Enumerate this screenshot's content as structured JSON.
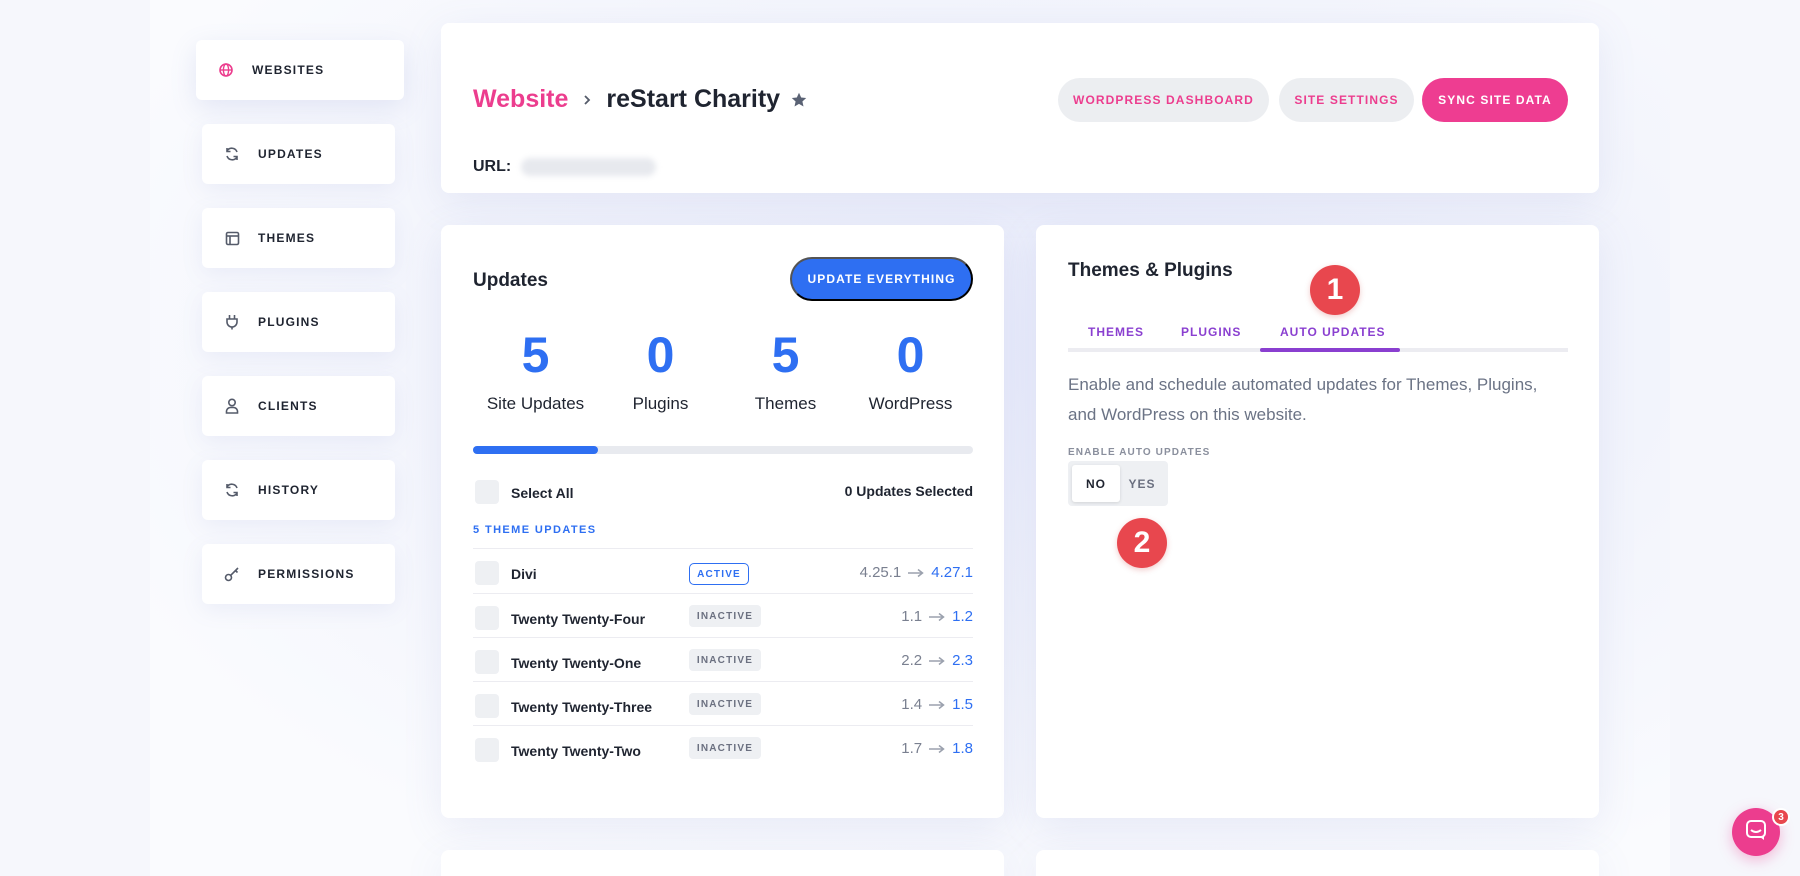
{
  "sidebar": {
    "items": [
      {
        "label": "WEBSITES",
        "icon": "globe-icon",
        "active": true
      },
      {
        "label": "UPDATES",
        "icon": "refresh-icon",
        "active": false
      },
      {
        "label": "THEMES",
        "icon": "layout-icon",
        "active": false
      },
      {
        "label": "PLUGINS",
        "icon": "plug-icon",
        "active": false
      },
      {
        "label": "CLIENTS",
        "icon": "user-icon",
        "active": false
      },
      {
        "label": "HISTORY",
        "icon": "history-icon",
        "active": false
      },
      {
        "label": "PERMISSIONS",
        "icon": "key-icon",
        "active": false
      }
    ]
  },
  "header": {
    "breadcrumb_root": "Website",
    "site_name": "reStart Charity",
    "url_label": "URL:",
    "buttons": {
      "wp_dashboard": "WORDPRESS DASHBOARD",
      "site_settings": "SITE SETTINGS",
      "sync": "SYNC SITE DATA"
    }
  },
  "updates": {
    "title": "Updates",
    "update_everything": "UPDATE EVERYTHING",
    "stats": [
      {
        "value": "5",
        "label": "Site Updates"
      },
      {
        "value": "0",
        "label": "Plugins"
      },
      {
        "value": "5",
        "label": "Themes"
      },
      {
        "value": "0",
        "label": "WordPress"
      }
    ],
    "progress_fraction": 0.25,
    "select_all": "Select All",
    "selected_count": "0 Updates Selected",
    "section_heading": "5 THEME UPDATES",
    "themes": [
      {
        "name": "Divi",
        "status": "ACTIVE",
        "from": "4.25.1",
        "to": "4.27.1"
      },
      {
        "name": "Twenty Twenty-Four",
        "status": "INACTIVE",
        "from": "1.1",
        "to": "1.2"
      },
      {
        "name": "Twenty Twenty-One",
        "status": "INACTIVE",
        "from": "2.2",
        "to": "2.3"
      },
      {
        "name": "Twenty Twenty-Three",
        "status": "INACTIVE",
        "from": "1.4",
        "to": "1.5"
      },
      {
        "name": "Twenty Twenty-Two",
        "status": "INACTIVE",
        "from": "1.7",
        "to": "1.8"
      }
    ]
  },
  "themes_plugins": {
    "title": "Themes & Plugins",
    "tabs": [
      "THEMES",
      "PLUGINS",
      "AUTO UPDATES"
    ],
    "active_tab": "AUTO UPDATES",
    "description": "Enable and schedule automated updates for Themes, Plugins, and WordPress on this website.",
    "toggle_label": "ENABLE AUTO UPDATES",
    "toggle_no": "NO",
    "toggle_yes": "YES",
    "markers": [
      "1",
      "2"
    ]
  },
  "chat": {
    "badge": "3"
  },
  "colors": {
    "pink": "#ec3d8e",
    "blue": "#2e6ff2",
    "purple": "#8a3fd0",
    "marker_red": "#e8474e"
  }
}
